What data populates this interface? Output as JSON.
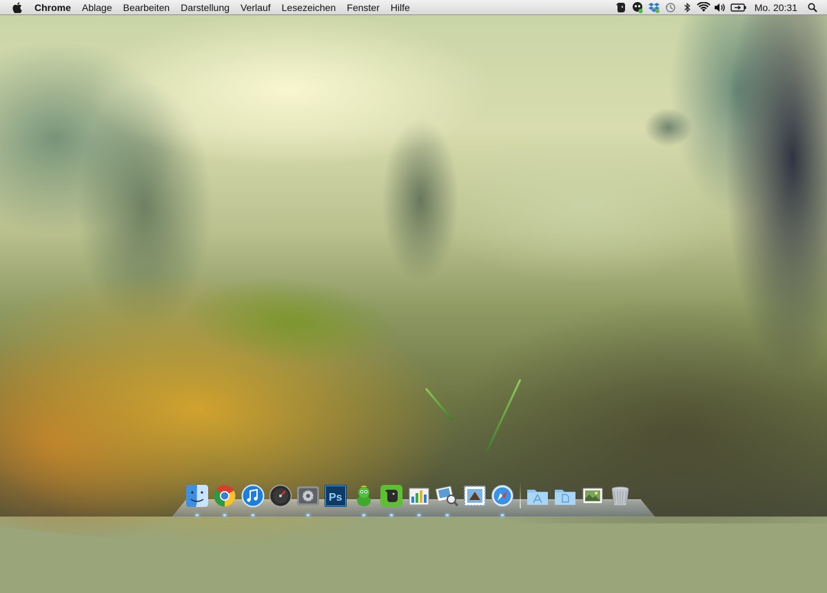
{
  "menubar": {
    "apple_icon": "apple-logo-icon",
    "app_name": "Chrome",
    "items": [
      "Ablage",
      "Bearbeiten",
      "Darstellung",
      "Verlauf",
      "Lesezeichen",
      "Fenster",
      "Hilfe"
    ],
    "status_icons": [
      "evernote-icon",
      "growl-icon",
      "dropbox-icon",
      "time-machine-icon",
      "bluetooth-icon",
      "wifi-icon",
      "volume-icon",
      "battery-icon"
    ],
    "clock": "Mo. 20:31",
    "search_icon": "spotlight-search-icon"
  },
  "dock": {
    "apps": [
      {
        "name": "finder-icon",
        "running": true
      },
      {
        "name": "chrome-icon",
        "running": true
      },
      {
        "name": "itunes-icon",
        "running": true
      },
      {
        "name": "dashboard-icon",
        "running": false
      },
      {
        "name": "system-preferences-icon",
        "running": true
      },
      {
        "name": "photoshop-icon",
        "running": false,
        "label": "Ps"
      },
      {
        "name": "adium-icon",
        "running": true
      },
      {
        "name": "evernote-icon",
        "running": true
      },
      {
        "name": "activity-monitor-icon",
        "running": true
      },
      {
        "name": "preview-icon",
        "running": true
      },
      {
        "name": "mail-icon",
        "running": false
      },
      {
        "name": "safari-icon",
        "running": true
      }
    ],
    "stacks": [
      {
        "name": "applications-folder-icon"
      },
      {
        "name": "documents-folder-icon"
      },
      {
        "name": "downloads-stack-icon"
      },
      {
        "name": "trash-icon"
      }
    ]
  },
  "colors": {
    "menubar_bg": "#e6e6e6",
    "dock_indicator": "#5aa0e0",
    "wallpaper_moss": "#d7a52d"
  }
}
